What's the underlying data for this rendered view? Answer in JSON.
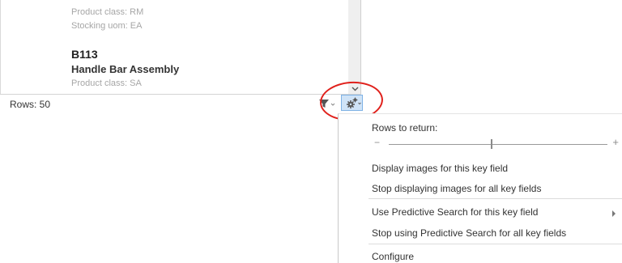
{
  "list": {
    "items": [
      {
        "product_class": "Product class: RM",
        "stocking_uom": "Stocking uom: EA"
      },
      {
        "code": "B113",
        "description": "Handle Bar Assembly",
        "product_class": "Product class: SA"
      }
    ]
  },
  "status_bar": {
    "rows_label": "Rows: 50"
  },
  "menu": {
    "rows_to_return": {
      "label": "Rows to return:",
      "value_fraction": 0.47
    },
    "items": [
      {
        "label": "Display images for this key field"
      },
      {
        "label": "Stop displaying images for all key fields"
      },
      {
        "label": "Use Predictive Search for this key field",
        "has_submenu": true
      },
      {
        "label": "Stop using Predictive Search for all key fields"
      },
      {
        "label": "Configure"
      }
    ]
  },
  "icons": {
    "filter": "filter-funnel-icon",
    "settings": "gears-icon",
    "scroll": "chevron-down-icon"
  },
  "colors": {
    "highlight_ring": "#e0211c",
    "gear_button_bg": "#cfe3f7",
    "gear_button_border": "#7fb2e5"
  }
}
